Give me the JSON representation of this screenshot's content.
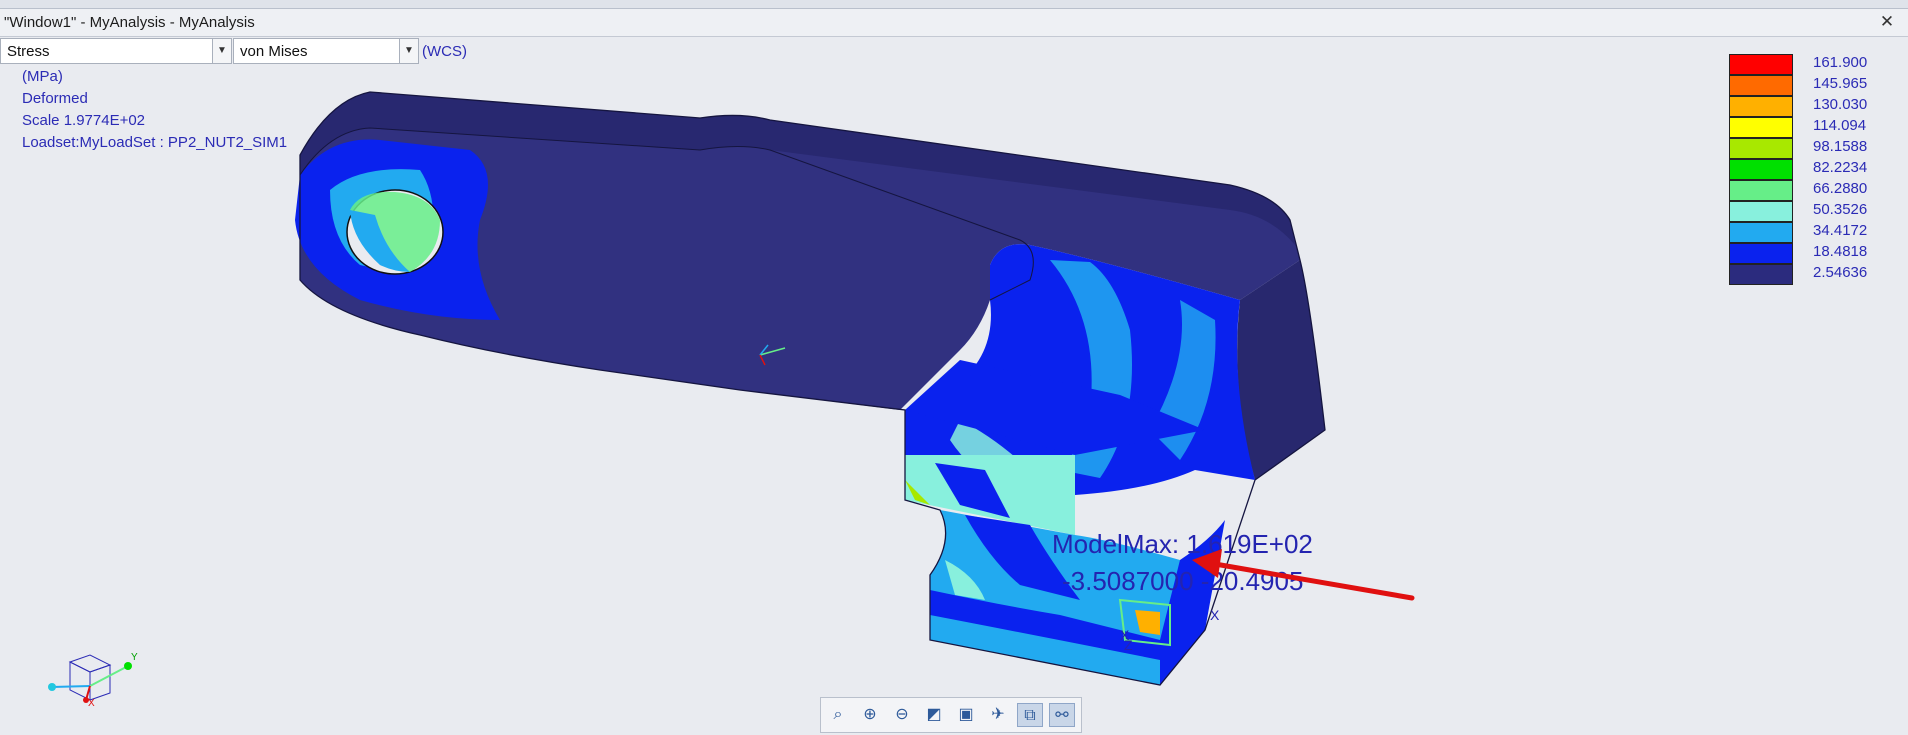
{
  "window": {
    "title": "\"Window1\" - MyAnalysis - MyAnalysis",
    "close_icon": "close-icon"
  },
  "toolbar": {
    "quantity": "Stress",
    "component": "von Mises",
    "csys": "(WCS)"
  },
  "info": {
    "units": "(MPa)",
    "mode": "Deformed",
    "scale": "Scale  1.9774E+02",
    "loadset": "Loadset:MyLoadSet :  PP2_NUT2_SIM1"
  },
  "legend": [
    {
      "value": "161.900",
      "color": "#ff0000"
    },
    {
      "value": "145.965",
      "color": "#ff6a00"
    },
    {
      "value": "130.030",
      "color": "#ffb000"
    },
    {
      "value": "114.094",
      "color": "#ffff00"
    },
    {
      "value": "98.1588",
      "color": "#a8e800"
    },
    {
      "value": "82.2234",
      "color": "#00e000"
    },
    {
      "value": "66.2880",
      "color": "#66ee88"
    },
    {
      "value": "50.3526",
      "color": "#88f0dd"
    },
    {
      "value": "34.4172",
      "color": "#22aaf0"
    },
    {
      "value": "18.4818",
      "color": "#0a22ee"
    },
    {
      "value": "2.54636",
      "color": "#2b2b7e"
    }
  ],
  "probe": {
    "line1": "ModelMax: 1.619E+02",
    "line2": "-3.5087000  -20.4905"
  },
  "triad": {
    "x": "X",
    "y": "Y",
    "z": "Z",
    "ax1": "X",
    "ax2": "Z",
    "ax3": "X"
  },
  "bottom_toolbar": {
    "buttons": [
      "zoom-fit-icon",
      "zoom-in-icon",
      "zoom-out-icon",
      "refit-icon",
      "named-view-icon",
      "spin-center-icon",
      "display-style-icon",
      "sketch-display-icon"
    ]
  },
  "colors": {
    "model_base": "#2e2e86",
    "accent_blue": "#2b2bb5",
    "arrow": "#e01010"
  }
}
